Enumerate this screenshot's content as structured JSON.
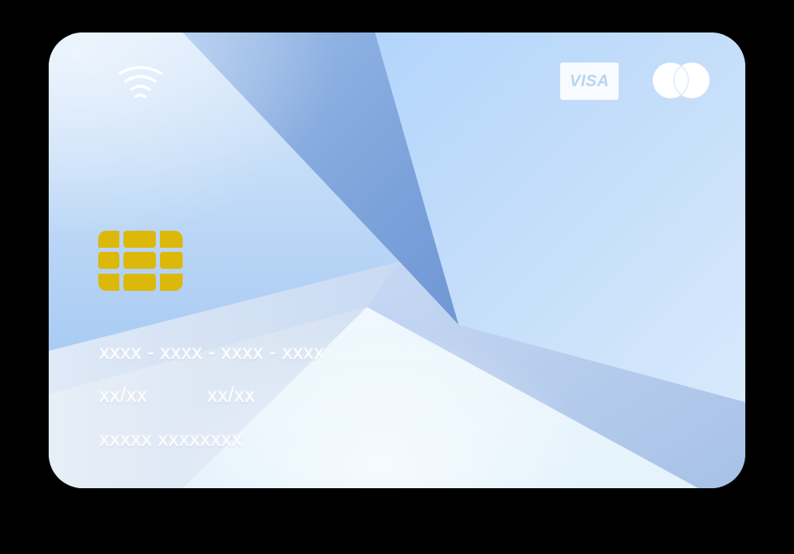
{
  "card": {
    "number": "xxxx - xxxx - xxxx - xxxx",
    "valid_from": "xx/xx",
    "valid_thru": "xx/xx",
    "holder": "xxxxx xxxxxxxx"
  },
  "brands": {
    "visa": "VISA",
    "mastercard": ""
  },
  "icons": {
    "contactless": "contactless-icon",
    "chip": "chip-icon"
  },
  "colors": {
    "background": "#000000",
    "card_base": "#d6e6f8",
    "chip": "#dcb80a",
    "text": "#ffffff",
    "facet_dark": "#7fa5dc",
    "facet_light": "#bcd9f8"
  }
}
